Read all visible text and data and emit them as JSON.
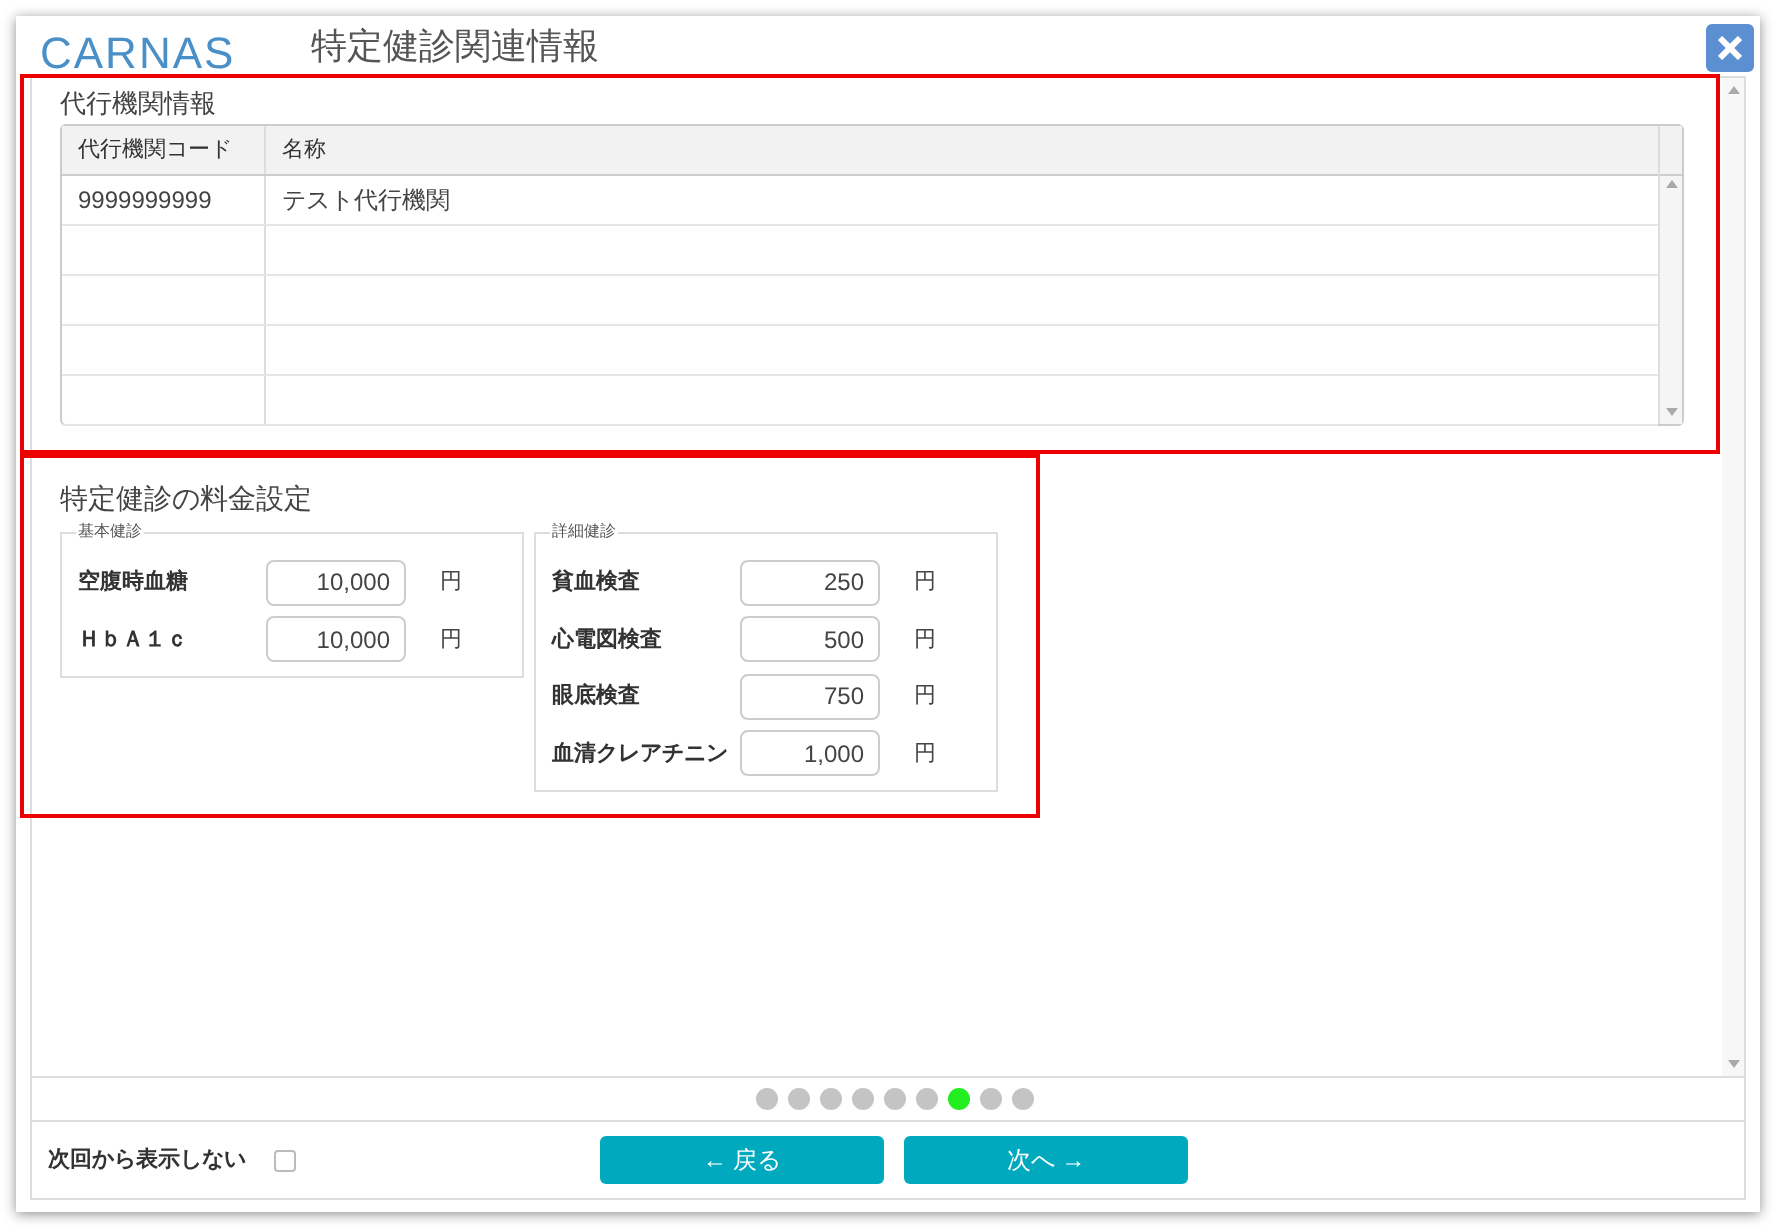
{
  "window": {
    "logo": "CARNAS",
    "title": "特定健診関連情報"
  },
  "agency_section": {
    "title": "代行機関情報",
    "highlighted": true,
    "table": {
      "columns": [
        "代行機関コード",
        "名称"
      ],
      "rows": [
        [
          "9999999999",
          "テスト代行機関"
        ],
        [
          "",
          ""
        ],
        [
          "",
          ""
        ],
        [
          "",
          ""
        ],
        [
          "",
          ""
        ]
      ]
    }
  },
  "fee_section": {
    "title": "特定健診の料金設定",
    "highlighted": true,
    "groups": [
      {
        "legend": "基本健診",
        "items": [
          {
            "label": "空腹時血糖",
            "value": "10,000",
            "unit": "円"
          },
          {
            "label": "ＨｂＡ１ｃ",
            "value": "10,000",
            "unit": "円"
          }
        ]
      },
      {
        "legend": "詳細健診",
        "items": [
          {
            "label": "貧血検査",
            "value": "250",
            "unit": "円"
          },
          {
            "label": "心電図検査",
            "value": "500",
            "unit": "円"
          },
          {
            "label": "眼底検査",
            "value": "750",
            "unit": "円"
          },
          {
            "label": "血清クレアチニン",
            "value": "1,000",
            "unit": "円"
          }
        ]
      }
    ]
  },
  "pager": [
    {
      "selected": false
    },
    {
      "selected": false
    },
    {
      "selected": false
    },
    {
      "selected": false
    },
    {
      "selected": false
    },
    {
      "selected": false
    },
    {
      "selected": true
    },
    {
      "selected": false
    },
    {
      "selected": false
    }
  ],
  "footer": {
    "dont_show_again": {
      "label": "次回から表示しない",
      "checked": false
    },
    "buttons": [
      {
        "label": "← 戻る"
      },
      {
        "label": "次へ →"
      }
    ]
  }
}
